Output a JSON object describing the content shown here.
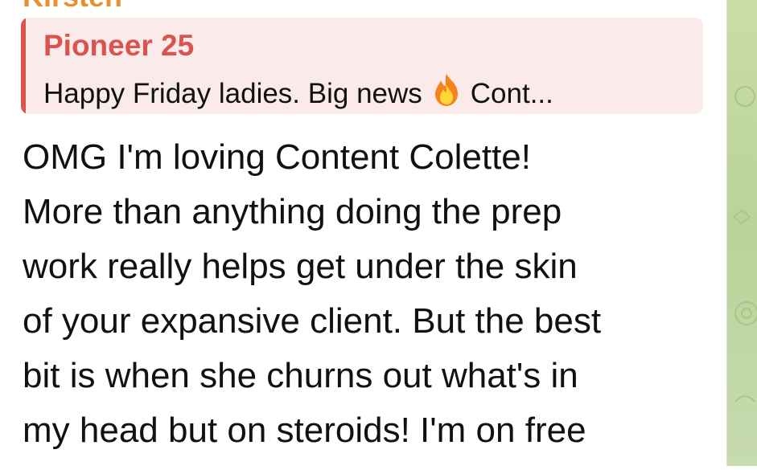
{
  "message": {
    "sender": "Kirsten",
    "reply": {
      "name": "Pioneer 25",
      "preview_before": "Happy Friday ladies. Big news",
      "preview_after": "Cont..."
    },
    "lines": [
      "OMG I'm loving Content Colette!",
      "More than anything doing the prep",
      "work really helps get under the skin",
      "of your expansive client. But the best",
      "bit is when she churns out what's in",
      "my head but on steroids! I'm on free"
    ]
  },
  "icons": {
    "reply_emoji": "fire-emoji"
  },
  "colors": {
    "sender": "#e8902d",
    "reply_accent": "#d9534f",
    "reply_bg": "#fbeaea",
    "wallpaper": "#b8d39a"
  }
}
